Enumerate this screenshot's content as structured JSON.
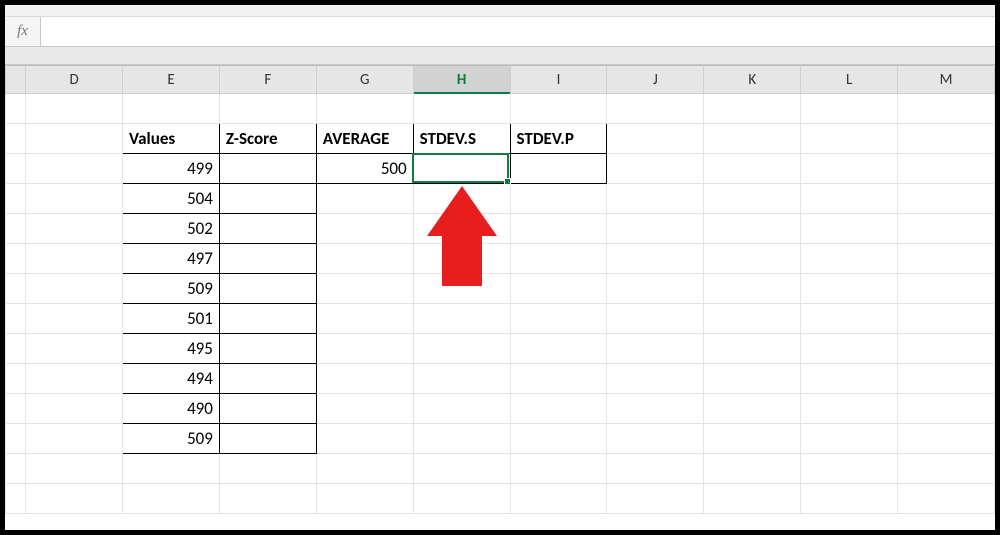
{
  "formula_bar": {
    "fx_label": "fx",
    "value": ""
  },
  "columns": [
    "D",
    "E",
    "F",
    "G",
    "H",
    "I",
    "J",
    "K",
    "L",
    "M"
  ],
  "active_column": "H",
  "headers_row": {
    "E": "Values",
    "F": "Z-Score",
    "G": "AVERAGE",
    "H": "STDEV.S",
    "I": "STDEV.P"
  },
  "data": {
    "values": [
      "499",
      "504",
      "502",
      "497",
      "509",
      "501",
      "495",
      "494",
      "490",
      "509"
    ],
    "average": "500",
    "stdev_s": "",
    "stdev_p": ""
  },
  "annotation": {
    "type": "arrow",
    "color": "#e81e1e",
    "points_at": "cell H (STDEV.S value cell)"
  },
  "chart_data": {
    "type": "table",
    "title": "",
    "columns": [
      "Values",
      "Z-Score",
      "AVERAGE",
      "STDEV.S",
      "STDEV.P"
    ],
    "rows": [
      {
        "Values": 499,
        "Z-Score": null,
        "AVERAGE": 500,
        "STDEV.S": null,
        "STDEV.P": null
      },
      {
        "Values": 504
      },
      {
        "Values": 502
      },
      {
        "Values": 497
      },
      {
        "Values": 509
      },
      {
        "Values": 501
      },
      {
        "Values": 495
      },
      {
        "Values": 494
      },
      {
        "Values": 490
      },
      {
        "Values": 509
      }
    ]
  }
}
